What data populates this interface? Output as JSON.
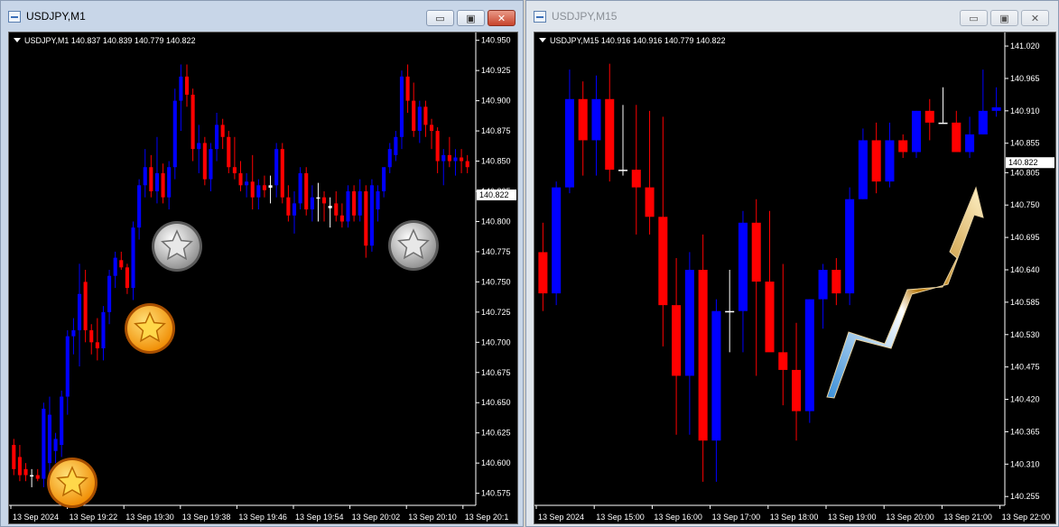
{
  "colors": {
    "bull": "#0000ff",
    "bear": "#ff0000",
    "doji": "#ffffff",
    "axis": "#ffffff",
    "background": "#000000",
    "price_label_bg": "#ffffff",
    "price_label_text": "#000000"
  },
  "windows": [
    {
      "title": "USDJPY,M1",
      "buttons": {
        "minimize": "▭",
        "restore": "▣",
        "close": "✕"
      }
    },
    {
      "title": "USDJPY,M15",
      "buttons": {
        "minimize": "▭",
        "restore": "▣",
        "close": "✕"
      }
    }
  ],
  "chart_data": [
    {
      "type": "candlestick",
      "symbol_header": "USDJPY,M1  140.837 140.839 140.779 140.822",
      "current_price": "140.822",
      "ylim": [
        140.565,
        140.955
      ],
      "y_ticks": [
        "140.950",
        "140.925",
        "140.900",
        "140.875",
        "140.850",
        "140.825",
        "140.800",
        "140.775",
        "140.750",
        "140.725",
        "140.700",
        "140.675",
        "140.650",
        "140.625",
        "140.600",
        "140.575"
      ],
      "x_ticks": [
        "13 Sep 2024",
        "13 Sep 19:22",
        "13 Sep 19:30",
        "13 Sep 19:38",
        "13 Sep 19:46",
        "13 Sep 19:54",
        "13 Sep 20:02",
        "13 Sep 20:10",
        "13 Sep 20:1"
      ],
      "decorations": [
        "gold-star-coin",
        "gold-star-coin",
        "silver-star-coin",
        "silver-star-coin"
      ],
      "candles": [
        [
          140.615,
          140.62,
          140.59,
          140.595
        ],
        [
          140.605,
          140.615,
          140.585,
          140.59
        ],
        [
          140.595,
          140.6,
          140.585,
          140.59
        ],
        [
          140.59,
          140.595,
          140.58,
          140.59
        ],
        [
          140.59,
          140.595,
          140.585,
          140.587
        ],
        [
          140.587,
          140.65,
          140.58,
          140.645
        ],
        [
          140.6,
          140.655,
          140.59,
          140.64
        ],
        [
          140.61,
          140.625,
          140.6,
          140.62
        ],
        [
          140.615,
          140.66,
          140.605,
          140.655
        ],
        [
          140.655,
          140.71,
          140.64,
          140.705
        ],
        [
          140.705,
          140.72,
          140.69,
          140.71
        ],
        [
          140.71,
          140.765,
          140.68,
          140.74
        ],
        [
          140.75,
          140.76,
          140.7,
          140.71
        ],
        [
          140.71,
          140.715,
          140.69,
          140.7
        ],
        [
          140.7,
          140.72,
          140.685,
          140.695
        ],
        [
          140.695,
          140.73,
          140.685,
          140.725
        ],
        [
          140.725,
          140.76,
          140.715,
          140.755
        ],
        [
          140.755,
          140.775,
          140.745,
          140.77
        ],
        [
          140.768,
          140.775,
          140.76,
          140.762
        ],
        [
          140.762,
          140.765,
          140.74,
          140.745
        ],
        [
          140.745,
          140.8,
          140.735,
          140.795
        ],
        [
          140.795,
          140.835,
          140.785,
          140.83
        ],
        [
          140.83,
          140.86,
          140.82,
          140.845
        ],
        [
          140.845,
          140.855,
          140.82,
          140.825
        ],
        [
          140.825,
          140.87,
          140.815,
          140.84
        ],
        [
          140.84,
          140.848,
          140.815,
          140.82
        ],
        [
          140.82,
          140.85,
          140.81,
          140.845
        ],
        [
          140.845,
          140.91,
          140.835,
          140.9
        ],
        [
          140.9,
          140.93,
          140.875,
          140.92
        ],
        [
          140.92,
          140.93,
          140.895,
          140.905
        ],
        [
          140.905,
          140.91,
          140.85,
          140.86
        ],
        [
          140.86,
          140.88,
          140.84,
          140.865
        ],
        [
          140.865,
          140.87,
          140.83,
          140.835
        ],
        [
          140.835,
          140.865,
          140.825,
          140.86
        ],
        [
          140.86,
          140.89,
          140.85,
          140.88
        ],
        [
          140.88,
          140.885,
          140.86,
          140.87
        ],
        [
          140.87,
          140.875,
          140.84,
          140.845
        ],
        [
          140.845,
          140.87,
          140.835,
          140.84
        ],
        [
          140.84,
          140.85,
          140.825,
          140.83
        ],
        [
          140.83,
          140.84,
          140.82,
          140.833
        ],
        [
          140.833,
          140.855,
          140.81,
          140.82
        ],
        [
          140.82,
          140.835,
          140.81,
          140.83
        ],
        [
          140.83,
          140.838,
          140.82,
          140.826
        ],
        [
          140.828,
          140.838,
          140.815,
          140.83
        ],
        [
          140.83,
          140.865,
          140.82,
          140.86
        ],
        [
          140.86,
          140.865,
          140.815,
          140.82
        ],
        [
          140.82,
          140.83,
          140.8,
          140.805
        ],
        [
          140.805,
          140.825,
          140.79,
          140.815
        ],
        [
          140.815,
          140.845,
          140.81,
          140.84
        ],
        [
          140.84,
          140.845,
          140.805,
          140.81
        ],
        [
          140.81,
          140.83,
          140.8,
          140.82
        ],
        [
          140.82,
          140.832,
          140.8,
          140.82
        ],
        [
          140.82,
          140.825,
          140.8,
          140.815
        ],
        [
          140.813,
          140.82,
          140.795,
          140.811
        ],
        [
          140.815,
          140.825,
          140.8,
          140.805
        ],
        [
          140.805,
          140.815,
          140.795,
          140.8
        ],
        [
          140.8,
          140.83,
          140.795,
          140.825
        ],
        [
          140.825,
          140.83,
          140.8,
          140.805
        ],
        [
          140.805,
          140.835,
          140.8,
          140.825
        ],
        [
          140.825,
          140.83,
          140.77,
          140.78
        ],
        [
          140.78,
          140.835,
          140.775,
          140.83
        ],
        [
          140.81,
          140.83,
          140.8,
          140.825
        ],
        [
          140.825,
          140.84,
          140.82,
          140.845
        ],
        [
          140.845,
          140.865,
          140.84,
          140.86
        ],
        [
          140.855,
          140.875,
          140.85,
          140.87
        ],
        [
          140.87,
          140.925,
          140.86,
          140.92
        ],
        [
          140.92,
          140.93,
          140.89,
          140.9
        ],
        [
          140.9,
          140.915,
          140.87,
          140.875
        ],
        [
          140.875,
          140.9,
          140.865,
          140.895
        ],
        [
          140.895,
          140.9,
          140.87,
          140.88
        ],
        [
          140.88,
          140.885,
          140.86,
          140.875
        ],
        [
          140.875,
          140.878,
          140.84,
          140.85
        ],
        [
          140.85,
          140.86,
          140.83,
          140.855
        ],
        [
          140.855,
          140.87,
          140.845,
          140.85
        ],
        [
          140.85,
          140.86,
          140.838,
          140.853
        ],
        [
          140.853,
          140.86,
          140.84,
          140.85
        ],
        [
          140.85,
          140.855,
          140.84,
          140.845
        ]
      ]
    },
    {
      "type": "candlestick",
      "symbol_header": "USDJPY,M15  140.916 140.916 140.779 140.822",
      "current_price": "140.822",
      "ylim": [
        140.24,
        141.04
      ],
      "y_ticks": [
        "141.020",
        "140.965",
        "140.910",
        "140.855",
        "140.805",
        "140.750",
        "140.695",
        "140.640",
        "140.585",
        "140.530",
        "140.475",
        "140.420",
        "140.365",
        "140.310",
        "140.255"
      ],
      "x_ticks": [
        "13 Sep 2024",
        "13 Sep 15:00",
        "13 Sep 16:00",
        "13 Sep 17:00",
        "13 Sep 18:00",
        "13 Sep 19:00",
        "13 Sep 20:00",
        "13 Sep 21:00",
        "13 Sep 22:00"
      ],
      "decorations": [
        "rising-arrow"
      ],
      "candles": [
        [
          140.67,
          140.72,
          140.57,
          140.6
        ],
        [
          140.6,
          140.79,
          140.58,
          140.78
        ],
        [
          140.78,
          140.98,
          140.77,
          140.93
        ],
        [
          140.93,
          140.96,
          140.8,
          140.86
        ],
        [
          140.86,
          140.97,
          140.8,
          140.93
        ],
        [
          140.93,
          140.99,
          140.79,
          140.81
        ],
        [
          140.81,
          140.92,
          140.8,
          140.81
        ],
        [
          140.81,
          140.92,
          140.7,
          140.78
        ],
        [
          140.78,
          140.91,
          140.7,
          140.73
        ],
        [
          140.73,
          140.9,
          140.51,
          140.58
        ],
        [
          140.58,
          140.66,
          140.36,
          140.46
        ],
        [
          140.46,
          140.67,
          140.36,
          140.64
        ],
        [
          140.64,
          140.7,
          140.28,
          140.35
        ],
        [
          140.35,
          140.59,
          140.28,
          140.57
        ],
        [
          140.57,
          140.64,
          140.5,
          140.57
        ],
        [
          140.57,
          140.74,
          140.5,
          140.72
        ],
        [
          140.72,
          140.76,
          140.46,
          140.62
        ],
        [
          140.62,
          140.74,
          140.55,
          140.5
        ],
        [
          140.5,
          140.65,
          140.41,
          140.47
        ],
        [
          140.47,
          140.55,
          140.35,
          140.4
        ],
        [
          140.4,
          140.59,
          140.38,
          140.59
        ],
        [
          140.59,
          140.65,
          140.54,
          140.64
        ],
        [
          140.64,
          140.66,
          140.58,
          140.6
        ],
        [
          140.6,
          140.78,
          140.58,
          140.76
        ],
        [
          140.76,
          140.88,
          140.76,
          140.86
        ],
        [
          140.86,
          140.89,
          140.77,
          140.79
        ],
        [
          140.79,
          140.89,
          140.78,
          140.86
        ],
        [
          140.86,
          140.87,
          140.83,
          140.84
        ],
        [
          140.84,
          140.91,
          140.83,
          140.91
        ],
        [
          140.91,
          140.93,
          140.86,
          140.89
        ],
        [
          140.89,
          140.95,
          140.89,
          140.89
        ],
        [
          140.89,
          140.91,
          140.84,
          140.84
        ],
        [
          140.84,
          140.9,
          140.83,
          140.87
        ],
        [
          140.87,
          140.98,
          140.87,
          140.91
        ],
        [
          140.91,
          140.95,
          140.9,
          140.916
        ]
      ]
    }
  ]
}
